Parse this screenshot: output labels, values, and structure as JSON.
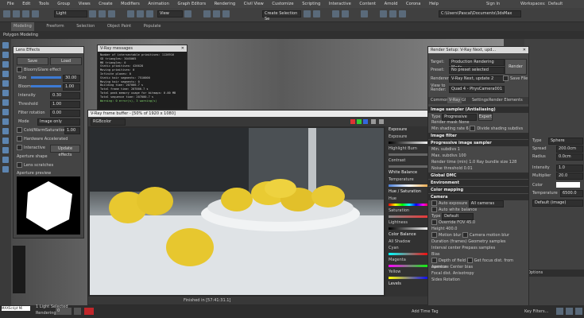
{
  "menu": [
    "File",
    "Edit",
    "Tools",
    "Group",
    "Views",
    "Create",
    "Modifiers",
    "Animation",
    "Graph Editors",
    "Rendering",
    "Civil View",
    "Customize",
    "Scripting",
    "Interactive",
    "Content",
    "Arnold",
    "Corona",
    "Help"
  ],
  "account": {
    "sign_in": "Sign In",
    "workspaces": "Workspaces:",
    "workspace_value": "Default"
  },
  "toolbar": {
    "light_dropdown": "Light",
    "view_dropdown": "View",
    "selection_set": "Create Selection Se",
    "path": "C:\\Users\\Pascal\\Documents\\3dsMax"
  },
  "ribbon": [
    "Modeling",
    "Freeform",
    "Selection",
    "Object Paint",
    "Populate"
  ],
  "polygon_modeling": "Polygon Modeling",
  "lens_effects": {
    "title": "Lens Effects",
    "save": "Save",
    "load": "Load",
    "bloom_glare": "Bloom/Glare effect",
    "size_label": "Size",
    "size_value": "30.00",
    "bloom_label": "Bloom",
    "bloom_value": "1.00",
    "intensity_label": "Intensity",
    "intensity_value": "0.30",
    "threshold_label": "Threshold",
    "threshold_value": "1.00",
    "filter_label": "Filter rotation",
    "filter_value": "0.00",
    "mode_label": "Mode",
    "mode_value": "Image only",
    "coldwarm": "Cold/Warm",
    "saturation_label": "Saturation",
    "saturation_value": "1.00",
    "hardware": "Hardware Accelerated",
    "interactive": "Interactive",
    "update": "Update effects",
    "aperture_shape": "Aperture shape",
    "lens_scratches": "Lens scratches",
    "aperture_preview": "Aperture preview"
  },
  "vray_messages": {
    "title": "V-Ray messages",
    "lines": [
      "Number of intersectable primitives: 1126916",
      "SD triangles: 3045065",
      "MB triangles: 0",
      "Static primitives: 426628",
      "Moving primitives: 0",
      "Infinite planes: 0",
      "Static hair segments: 7510000",
      "Moving hair segments: 0",
      "Building time: 207000.7 s",
      "Total frame time: 207000.7 s",
      "Total peak memory usage for bitmaps: 0.00 MB",
      "Total sequence time: 207000.7 s",
      "Warning: 0 error(s), 3 warning(s)"
    ]
  },
  "vfb": {
    "title": "V-Ray frame buffer - [50% of 1920 x 1080]",
    "channel": "RGBcolor",
    "status": "Finished in [57:41:31.1]",
    "side": {
      "exposure": "Exposure",
      "exposure_label": "Exposure",
      "highlight_burn": "Highlight Burn",
      "contrast": "Contrast",
      "white_balance": "White Balance",
      "temperature": "Temperature",
      "hue_sat": "Hue / Saturation",
      "hue": "Hue",
      "saturation": "Saturation",
      "lightness": "Lightness",
      "color_balance": "Color Balance",
      "all": "All",
      "shadows": "Shadow",
      "cyan": "Cyan",
      "magenta": "Magenta",
      "yellow": "Yellow",
      "levels": "Levels"
    }
  },
  "render_setup": {
    "title": "Render Setup: V-Ray Next, upd...",
    "target_label": "Target:",
    "target_value": "Production Rendering Mode",
    "preset_label": "Preset:",
    "preset_value": "No preset selected",
    "renderer_label": "Renderer:",
    "renderer_value": "V-Ray Next, update 2",
    "save_file": "Save File",
    "view_label": "View to Render:",
    "view_value": "Quad 4 - PhysCamera001",
    "render_button": "Render",
    "tabs": [
      "Common",
      "V-Ray",
      "GI",
      "Settings",
      "Render Elements"
    ],
    "image_sampler_title": "Image sampler (Antialiasing)",
    "type_label": "Type",
    "type_value": "Progressive",
    "expert": "Expert",
    "render_mask_label": "Render mask",
    "render_mask_value": "None",
    "min_shading_label": "Min shading rate",
    "min_shading_value": "6",
    "divide_shading": "Divide shading subdivs",
    "image_filter": "Image filter",
    "progressive_title": "Progressive image sampler",
    "min_subdivs_label": "Min. subdivs",
    "min_subdivs_value": "1",
    "max_subdivs_label": "Max. subdivs",
    "max_subdivs_value": "100",
    "render_time_label": "Render time (min)",
    "render_time_value": "1.0",
    "ray_bundle_label": "Ray bundle size",
    "ray_bundle_value": "128",
    "noise_label": "Noise threshold",
    "noise_value": "0.01",
    "global_dmc": "Global DMC",
    "environment": "Environment",
    "color_mapping": "Color mapping",
    "camera": "Camera",
    "auto_exposure": "Auto exposure",
    "auto_wb": "Auto white balance",
    "all_cameras": "All cameras",
    "type2_label": "Type",
    "type2_value": "Default",
    "override_fov": "Override FOV",
    "override_fov_value": "45.0",
    "height_label": "Height",
    "height_value": "400.0",
    "motion_blur": "Motion blur",
    "camera_motion_blur": "Camera motion blur",
    "duration_label": "Duration (frames)",
    "interval_label": "Interval center",
    "bias_label": "Bias",
    "prepass_label": "Prepass samples",
    "geometry_samples": "Geometry samples",
    "dof": "Depth of field",
    "get_focus": "Get focus dist. from camera",
    "aperture_label": "Aperture",
    "center_bias_label": "Center bias",
    "focal_label": "Focal dist.",
    "anisotropy_label": "Anisotropy",
    "sides_label": "Sides",
    "rotation_label": "Rotation"
  },
  "right_panel": {
    "type_label": "Type",
    "type_value": "Sphere",
    "spread_label": "Spread",
    "spread_value": "200.0cm",
    "radius_label": "Radius",
    "radius_value": "0.0cm",
    "intensity_label": "Intensity",
    "intensity_value": "1.0",
    "multiplier_label": "Multiplier",
    "multiplier_value": "20.0",
    "color_label": "Color",
    "temperature_label": "Temperature",
    "temperature_value": "6500.0",
    "default_image": "Default (image)",
    "options": "Options",
    "add_time_tag": "Add Time Tag",
    "key_filters": "Key Filters..."
  },
  "status": {
    "script": "MAXScript Mi",
    "lights_selected": "1 Light Selected",
    "rendering": "Rendering",
    "frame_value": "0"
  }
}
